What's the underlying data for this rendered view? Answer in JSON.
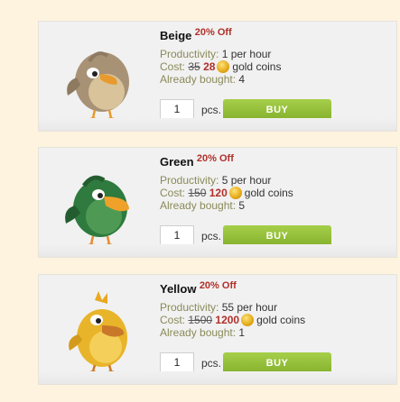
{
  "items": [
    {
      "name": "Beige",
      "discount": "20% Off",
      "productivity_label": "Productivity:",
      "productivity_value": "1 per hour",
      "cost_label": "Cost:",
      "old_price": "35",
      "new_price": "28",
      "currency": "gold coins",
      "bought_label": "Already bought:",
      "bought_value": "4",
      "quantity": "1",
      "pcs": "pcs.",
      "buy": "BUY",
      "colors": {
        "body": "#a89276",
        "belly": "#d8c39a",
        "beak": "#e89a2c"
      },
      "icon": "beige-bird-icon"
    },
    {
      "name": "Green",
      "discount": "20% Off",
      "productivity_label": "Productivity:",
      "productivity_value": "5 per hour",
      "cost_label": "Cost:",
      "old_price": "150",
      "new_price": "120",
      "currency": "gold coins",
      "bought_label": "Already bought:",
      "bought_value": "5",
      "quantity": "1",
      "pcs": "pcs.",
      "buy": "BUY",
      "colors": {
        "body": "#2f7a3e",
        "belly": "#4e9a55",
        "beak": "#f0a12a"
      },
      "icon": "green-bird-icon"
    },
    {
      "name": "Yellow",
      "discount": "20% Off",
      "productivity_label": "Productivity:",
      "productivity_value": "55 per hour",
      "cost_label": "Cost:",
      "old_price": "1500",
      "new_price": "1200",
      "currency": "gold coins",
      "bought_label": "Already bought:",
      "bought_value": "1",
      "quantity": "1",
      "pcs": "pcs.",
      "buy": "BUY",
      "colors": {
        "body": "#e8b52a",
        "belly": "#f4cf5a",
        "beak": "#c9782a"
      },
      "icon": "yellow-bird-icon"
    }
  ]
}
